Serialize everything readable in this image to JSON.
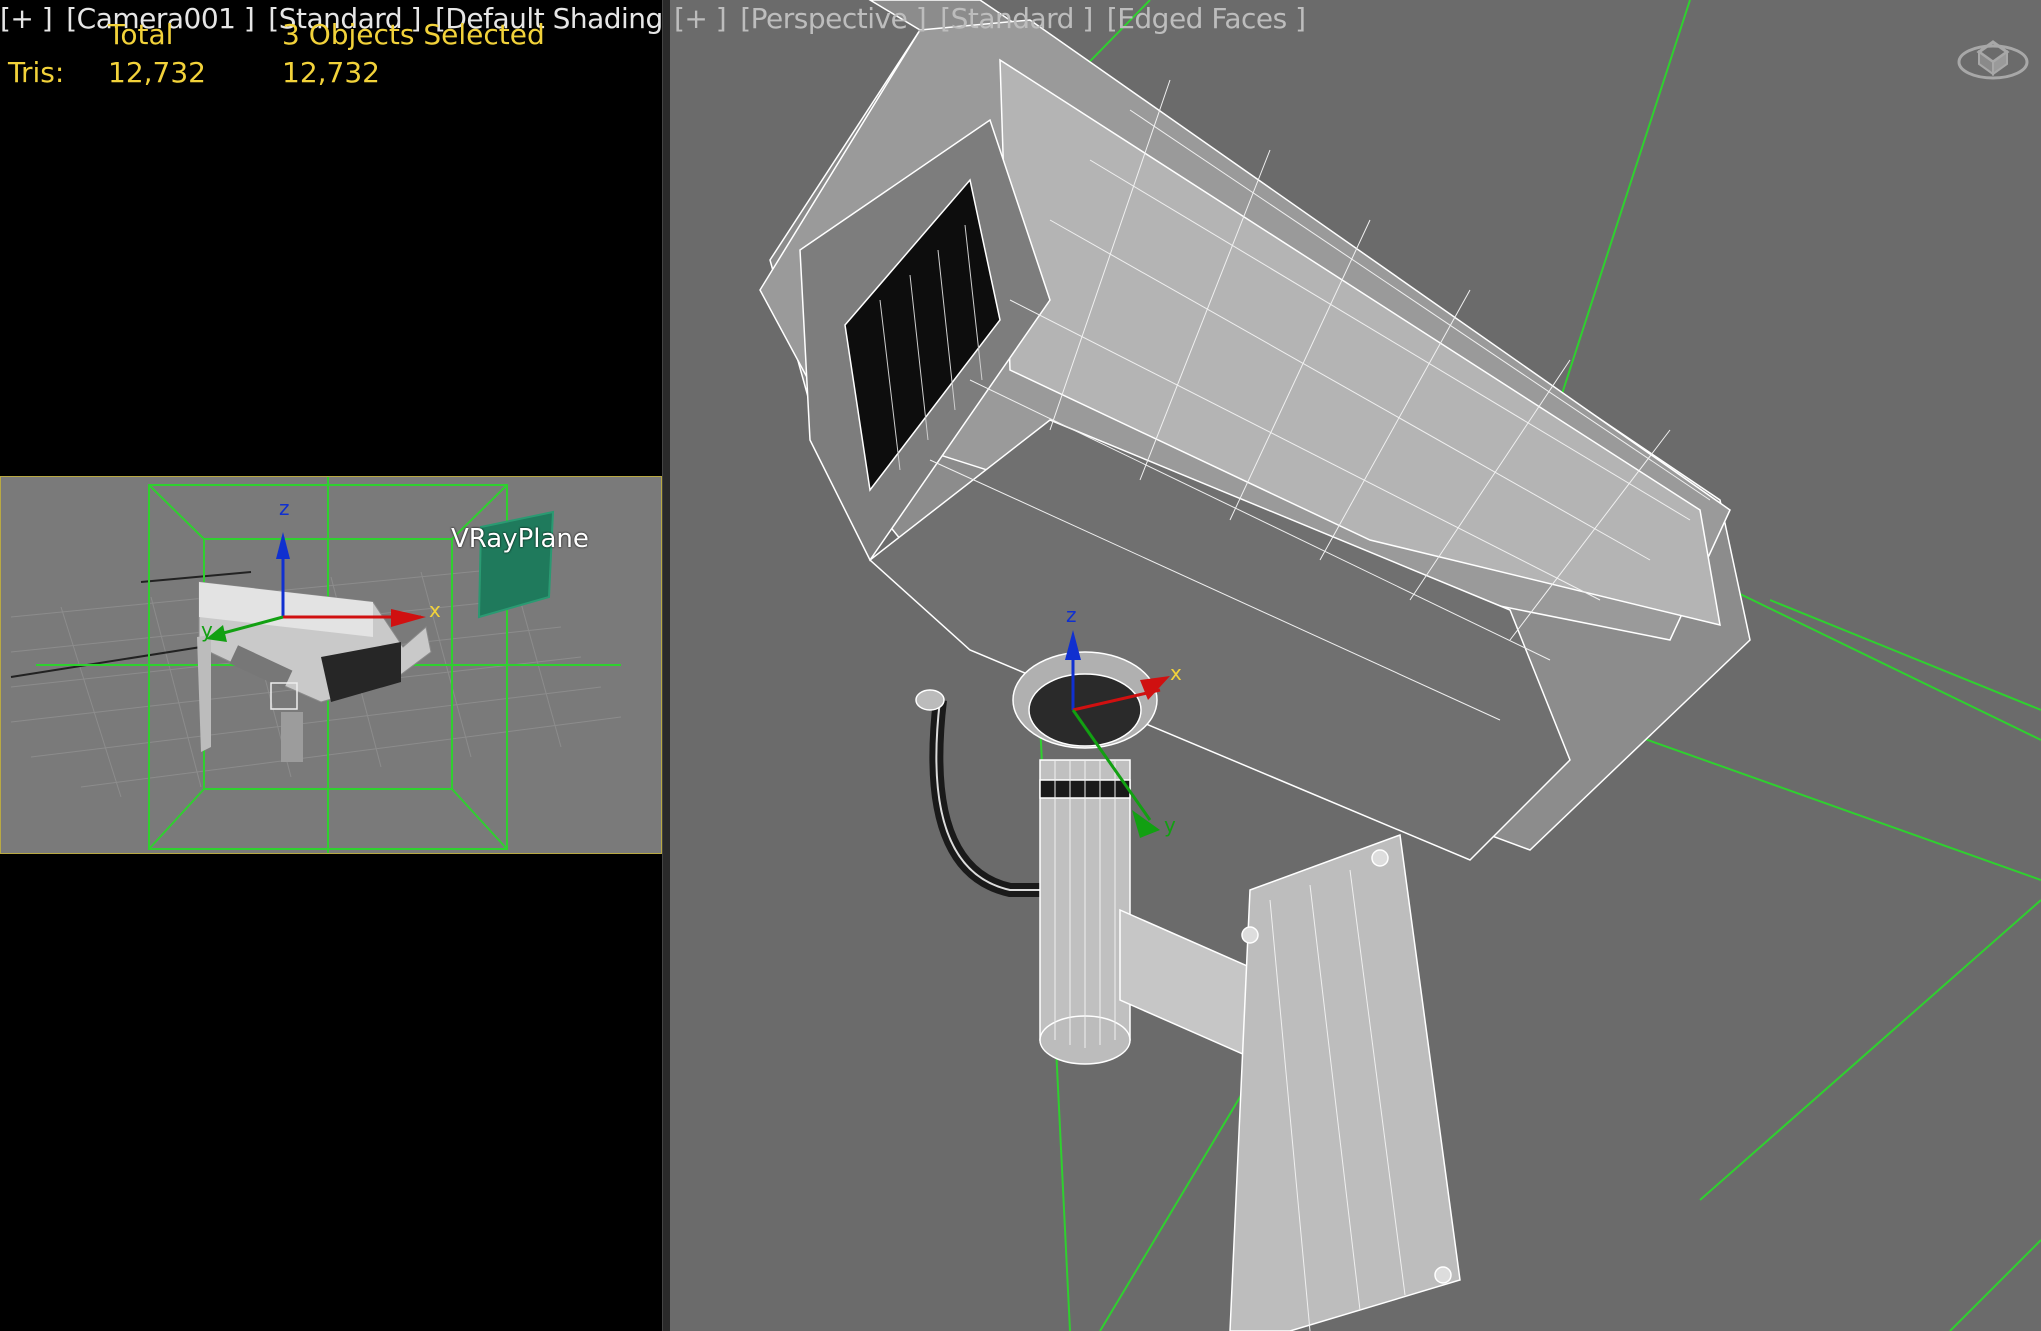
{
  "left_viewport": {
    "label_plus": "[+ ]",
    "label_camera": "[Camera001 ]",
    "label_standard": "[Standard ]",
    "label_shading": "[Default Shading ]",
    "stats": {
      "col_total": "Total",
      "col_selected": "3 Objects Selected",
      "row_label": "Tris:",
      "total_value": "12,732",
      "selected_value": "12,732"
    },
    "inset": {
      "object_label": "VRayPlane",
      "axis_x": "x",
      "axis_y": "y",
      "axis_z": "z"
    }
  },
  "right_viewport": {
    "label_plus": "[+ ]",
    "label_perspective": "[Perspective ]",
    "label_standard": "[Standard ]",
    "label_edged": "[Edged Faces ]",
    "axis_x": "x",
    "axis_y": "y",
    "axis_z": "z"
  },
  "colors": {
    "stats_text": "#f2d23a",
    "viewport_bg": "#6b6b6b",
    "selection_green": "#2fd02f",
    "axis_x": "#d01010",
    "axis_y": "#12a012",
    "axis_z": "#1030d0",
    "inset_border": "#b9a943"
  },
  "icons": {
    "nav_cube": "viewcube-icon"
  }
}
